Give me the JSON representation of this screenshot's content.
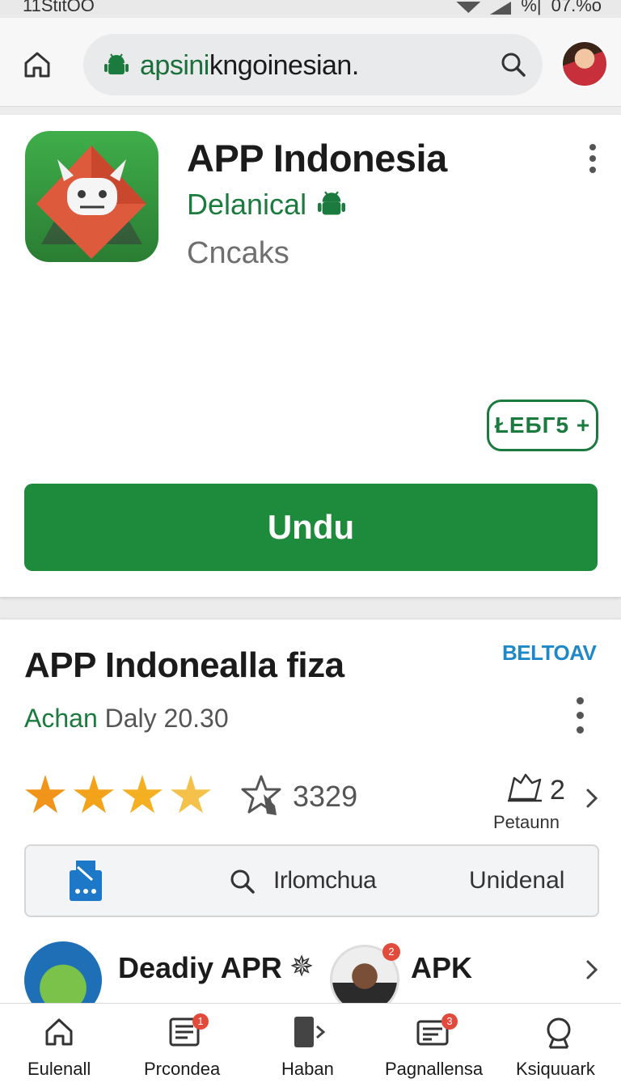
{
  "status": {
    "time": "11StitOO",
    "signal": "%|",
    "battery": "07.%o"
  },
  "addressbar": {
    "url_green": "apsini",
    "url_rest": "kngoinesian."
  },
  "app": {
    "title": "APP Indonesia",
    "developer": "Delanical",
    "category": "Cncaks",
    "badge": "ŁEБГ5 +",
    "install_label": "Undu"
  },
  "section": {
    "title": "APP Indonealla fiza",
    "tag": "BELTOAV",
    "author": "Achan",
    "date": "Daly 20.30",
    "rating_stars": 4,
    "rating_count": "3329",
    "reviews_count": "2",
    "reviews_label": "Petaunn",
    "infobar": {
      "query": "Irlomchua",
      "right": "Unidenal"
    },
    "related": {
      "item1": "Deadiy APR",
      "item2": "APK",
      "badge2": "2"
    }
  },
  "nav": [
    {
      "label": "Eulenall",
      "icon": "home-icon"
    },
    {
      "label": "Prcondea",
      "icon": "list-icon",
      "badge": "1"
    },
    {
      "label": "Haban",
      "icon": "device-arrow-icon"
    },
    {
      "label": "Pagnallensa",
      "icon": "slides-icon",
      "badge": "3"
    },
    {
      "label": "Ksiquuark",
      "icon": "search-icon"
    }
  ],
  "colors": {
    "accent": "#1e8a3c",
    "link": "#1e88c8",
    "star": "#f2a31a"
  }
}
